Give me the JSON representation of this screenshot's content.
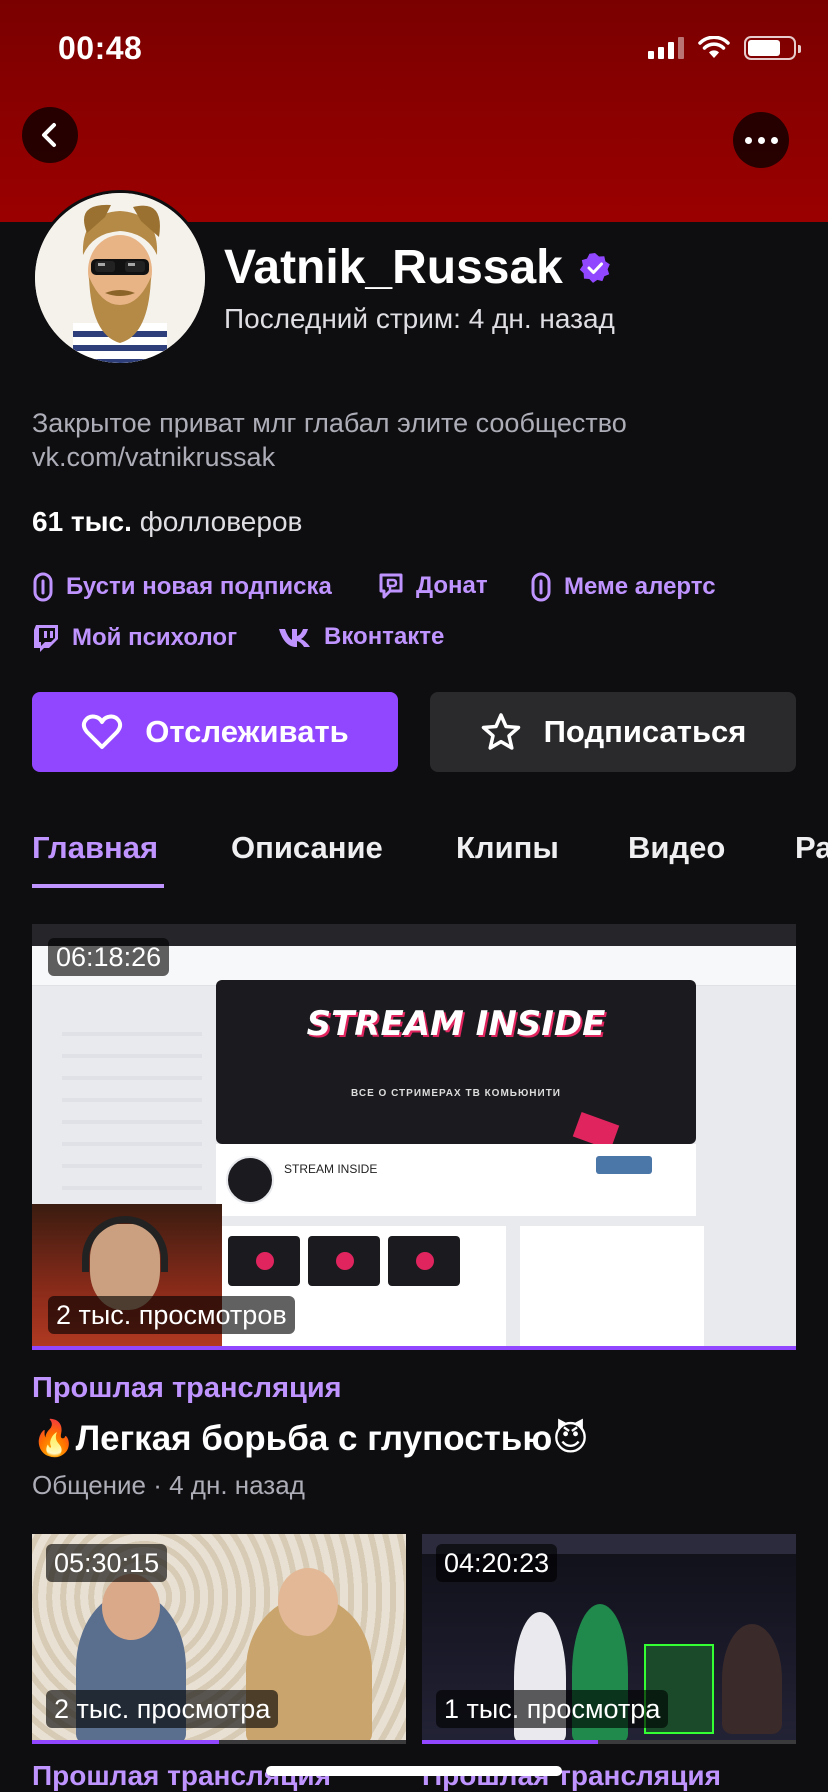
{
  "status_bar": {
    "time": "00:48"
  },
  "header": {
    "color": "#9b0000"
  },
  "channel": {
    "name": "Vatnik_Russak",
    "verified": true,
    "last_stream": "Последний стрим: 4 дн. назад",
    "description_line1": "Закрытое приват млг глабал элите сообщество",
    "description_line2": "vk.com/vatnikrussak",
    "followers_count": "61 тыс.",
    "followers_label": "фолловеров"
  },
  "links": [
    {
      "label": "Бусти новая подписка",
      "icon": "link-icon"
    },
    {
      "label": "Донат",
      "icon": "donation-icon"
    },
    {
      "label": "Меме алертс",
      "icon": "link-icon"
    },
    {
      "label": "Мой психолог",
      "icon": "twitch-icon"
    },
    {
      "label": "Вконтакте",
      "icon": "vk-icon"
    }
  ],
  "actions": {
    "follow_label": "Отслеживать",
    "subscribe_label": "Подписаться"
  },
  "tabs": [
    "Главная",
    "Описание",
    "Клипы",
    "Видео",
    "Ра"
  ],
  "active_tab": "Главная",
  "featured_video": {
    "duration": "06:18:26",
    "views": "2 тыс. просмотров",
    "kind": "Прошлая трансляция",
    "title": "🔥Легкая борьба с глупостью😈",
    "meta": "Общение · 4 дн. назад",
    "progress": 1.0
  },
  "thumb_text": {
    "banner": "STREAM INSIDE",
    "banner_sub": "ВСЕ О СТРИМЕРАХ ТВ КОМЬЮНИТИ",
    "page_name": "STREAM INSIDE"
  },
  "videos": [
    {
      "duration": "05:30:15",
      "views": "2 тыс. просмотра",
      "kind": "Прошлая трансляция",
      "progress": 0.5
    },
    {
      "duration": "04:20:23",
      "views": "1 тыс. просмотра",
      "kind": "Прошлая трансляция",
      "progress": 0.47
    }
  ],
  "colors": {
    "accent": "#9147ff",
    "accent_text": "#bf94ff",
    "background": "#0e0e10"
  }
}
